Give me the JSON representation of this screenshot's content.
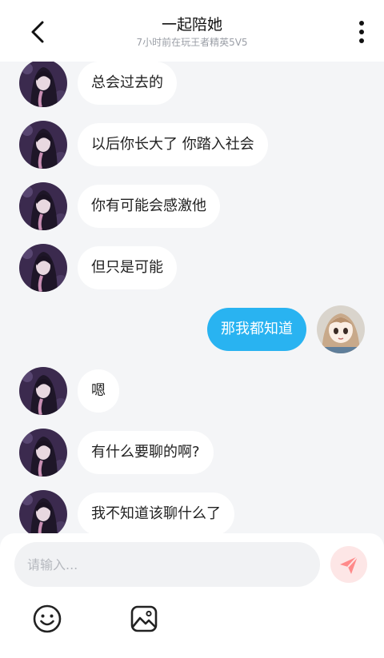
{
  "header": {
    "title": "一起陪她",
    "subtitle": "7小时前在玩王者精英5V5"
  },
  "messages": [
    {
      "side": "left",
      "text": "总会过去的"
    },
    {
      "side": "left",
      "text": "以后你长大了 你踏入社会"
    },
    {
      "side": "left",
      "text": "你有可能会感激他"
    },
    {
      "side": "left",
      "text": "但只是可能"
    },
    {
      "side": "right",
      "text": "那我都知道"
    },
    {
      "side": "left",
      "text": "嗯"
    },
    {
      "side": "left",
      "text": "有什么要聊的啊?"
    },
    {
      "side": "left",
      "text": "我不知道该聊什么了"
    }
  ],
  "input": {
    "placeholder": "请输入..."
  },
  "icons": {
    "back": "chevron-left-icon",
    "more": "more-vertical-icon",
    "send": "send-icon",
    "emoji": "emoji-icon",
    "image": "image-icon"
  },
  "colors": {
    "outgoing_bubble": "#29b3f1",
    "incoming_bubble": "#ffffff",
    "background": "#f4f5f7",
    "send_button": "#fde6e6",
    "send_icon": "#ff8a8a"
  }
}
